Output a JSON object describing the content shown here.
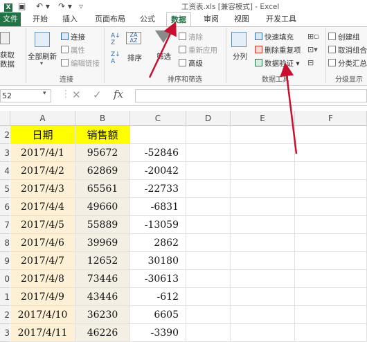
{
  "titlebar": {
    "title": "工资表.xls  [兼容模式] - Excel"
  },
  "tabs": {
    "file": "文件",
    "start": "开始",
    "insert": "插入",
    "layout": "页面布局",
    "formula": "公式",
    "data": "数据",
    "review": "审阅",
    "view": "视图",
    "dev": "开发工具"
  },
  "ribbon": {
    "get_data": [
      "获取",
      "数据"
    ],
    "refresh_all": "全部刷新",
    "conn": "连接",
    "props": "属性",
    "edit_links": "编辑链接",
    "group_conn": "连接",
    "sort": "排序",
    "filter": "筛选",
    "clear": "清除",
    "reapply": "重新应用",
    "advanced": "高级",
    "group_sort": "排序和筛选",
    "split": "分列",
    "flash_fill": "快速填充",
    "remove_dup": "删除重复项",
    "validation": "数据验证",
    "group_tools": "数据工具",
    "group_create": "创建组",
    "ungroup": "取消组合",
    "subtotal": "分类汇总",
    "group_outline": "分级显示"
  },
  "formula_bar": {
    "namebox": "52",
    "fx": "fx"
  },
  "grid": {
    "columns": [
      "A",
      "B",
      "C",
      "D",
      "E",
      "F"
    ],
    "row_numbers": [
      "2",
      "3",
      "4",
      "5",
      "6",
      "7",
      "8",
      "9",
      "0",
      "1",
      "2",
      "3"
    ],
    "header": {
      "a": "日期",
      "b": "销售额"
    },
    "rows": [
      {
        "a": "2017/4/1",
        "b": "95672",
        "c": "-52846"
      },
      {
        "a": "2017/4/2",
        "b": "62869",
        "c": "-20042"
      },
      {
        "a": "2017/4/3",
        "b": "65561",
        "c": "-22733"
      },
      {
        "a": "2017/4/4",
        "b": "49660",
        "c": "-6831"
      },
      {
        "a": "2017/4/5",
        "b": "55889",
        "c": "-13059"
      },
      {
        "a": "2017/4/6",
        "b": "39969",
        "c": "2862"
      },
      {
        "a": "2017/4/7",
        "b": "12652",
        "c": "30180"
      },
      {
        "a": "2017/4/8",
        "b": "73446",
        "c": "-30613"
      },
      {
        "a": "2017/4/9",
        "b": "43446",
        "c": "-612"
      },
      {
        "a": "2017/4/10",
        "b": "36230",
        "c": "6605"
      },
      {
        "a": "2017/4/11",
        "b": "46226",
        "c": "-3390"
      }
    ]
  },
  "colors": {
    "excel_green": "#217346",
    "header_yellow": "#ffff00",
    "annotation_red": "#c8102e"
  }
}
